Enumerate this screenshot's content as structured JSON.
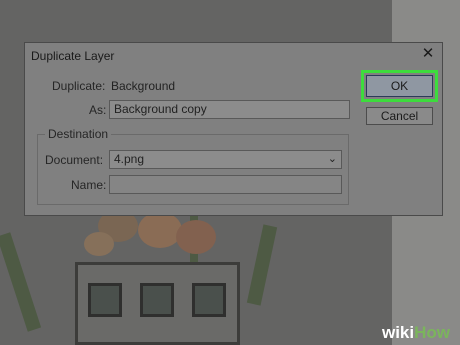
{
  "dialog": {
    "title": "Duplicate Layer",
    "duplicate_label": "Duplicate:",
    "duplicate_value": "Background",
    "as_label": "As:",
    "as_value": "Background copy",
    "destination_legend": "Destination",
    "document_label": "Document:",
    "document_value": "4.png",
    "name_label": "Name:",
    "name_value": "",
    "ok_label": "OK",
    "cancel_label": "Cancel",
    "close_glyph": "✕"
  },
  "watermark": {
    "part1": "wiki",
    "part2": "How"
  },
  "colors": {
    "highlight": "#3ddc3d"
  }
}
